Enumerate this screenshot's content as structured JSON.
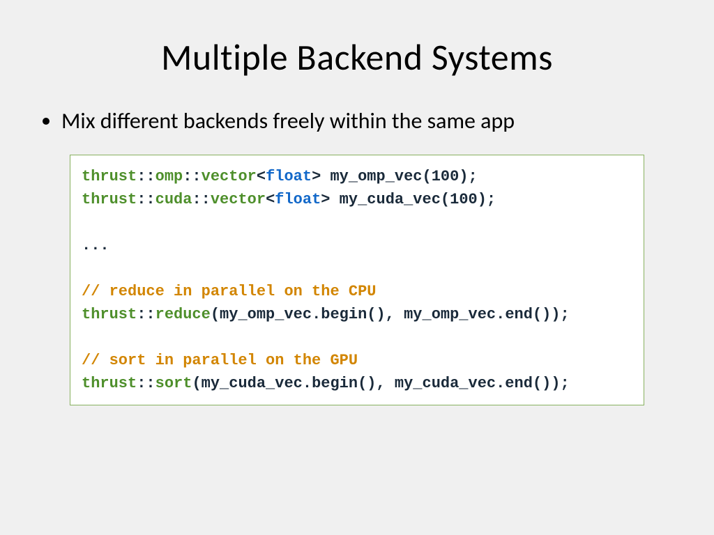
{
  "slide": {
    "title": "Multiple Backend Systems",
    "bullet1": "Mix different backends freely within the same app",
    "code": {
      "l1": {
        "t0": "thrust",
        "c0": "::",
        "t1": "omp",
        "c1": "::",
        "t2": "vector",
        "lt": "<",
        "ty": "float",
        "gt": ">",
        "rest": " my_omp_vec(100);"
      },
      "l2": {
        "t0": "thrust",
        "c0": "::",
        "t1": "cuda",
        "c1": "::",
        "t2": "vector",
        "lt": "<",
        "ty": "float",
        "gt": ">",
        "rest": " my_cuda_vec(100);"
      },
      "blank1": "",
      "l3": "...",
      "blank2": "",
      "c1": "// reduce in parallel on the CPU",
      "l4": {
        "t0": "thrust",
        "c0": "::",
        "t1": "reduce",
        "rest": "(my_omp_vec.begin(), my_omp_vec.end());"
      },
      "blank3": "",
      "c2": "// sort in parallel on the GPU",
      "l5": {
        "t0": "thrust",
        "c0": "::",
        "t1": "sort",
        "rest": "(my_cuda_vec.begin(), my_cuda_vec.end());"
      }
    }
  }
}
